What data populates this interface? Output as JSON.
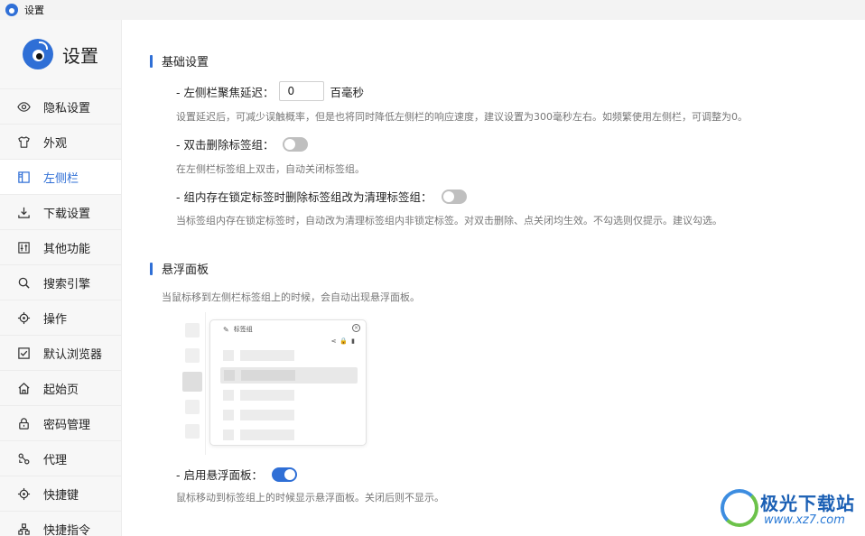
{
  "window": {
    "title": "设置"
  },
  "sidebar": {
    "title": "设置",
    "items": [
      {
        "label": "隐私设置",
        "icon": "eye-icon"
      },
      {
        "label": "外观",
        "icon": "shirt-icon"
      },
      {
        "label": "左侧栏",
        "icon": "sidebar-layout-icon",
        "active": true
      },
      {
        "label": "下载设置",
        "icon": "download-icon"
      },
      {
        "label": "其他功能",
        "icon": "sliders-icon"
      },
      {
        "label": "搜索引擎",
        "icon": "search-icon"
      },
      {
        "label": "操作",
        "icon": "crosshair-icon"
      },
      {
        "label": "默认浏览器",
        "icon": "checkbox-icon"
      },
      {
        "label": "起始页",
        "icon": "home-icon"
      },
      {
        "label": "密码管理",
        "icon": "lock-icon"
      },
      {
        "label": "代理",
        "icon": "proxy-icon"
      },
      {
        "label": "快捷键",
        "icon": "target-icon"
      },
      {
        "label": "快捷指令",
        "icon": "command-icon"
      }
    ]
  },
  "basic": {
    "title": "基础设置",
    "delay_label": "- 左侧栏聚焦延迟：",
    "delay_value": "0",
    "delay_unit": "百毫秒",
    "delay_desc": "设置延迟后，可减少误触概率，但是也将同时降低左侧栏的响应速度，建议设置为300毫秒左右。如频繁使用左侧栏，可调整为0。",
    "dblclick_label": "- 双击删除标签组：",
    "dblclick_on": false,
    "dblclick_desc": "在左侧栏标签组上双击，自动关闭标签组。",
    "locked_label": "- 组内存在锁定标签时删除标签组改为清理标签组：",
    "locked_on": false,
    "locked_desc": "当标签组内存在锁定标签时，自动改为清理标签组内非锁定标签。对双击删除、点关闭均生效。不勾选则仅提示。建议勾选。"
  },
  "hover": {
    "title": "悬浮面板",
    "intro": "当鼠标移到左侧栏标签组上的时候，会自动出现悬浮面板。",
    "preview_title": "标签组",
    "enable_label": "- 启用悬浮面板：",
    "enable_on": true,
    "enable_desc": "鼠标移动到标签组上的时候显示悬浮面板。关闭后则不显示。"
  },
  "watermark": {
    "title": "极光下载站",
    "url": "www.xz7.com"
  },
  "colors": {
    "accent": "#2f6fd6",
    "toggle_off": "#bfbfbf",
    "sidebar_bg": "#f7f7f7"
  }
}
